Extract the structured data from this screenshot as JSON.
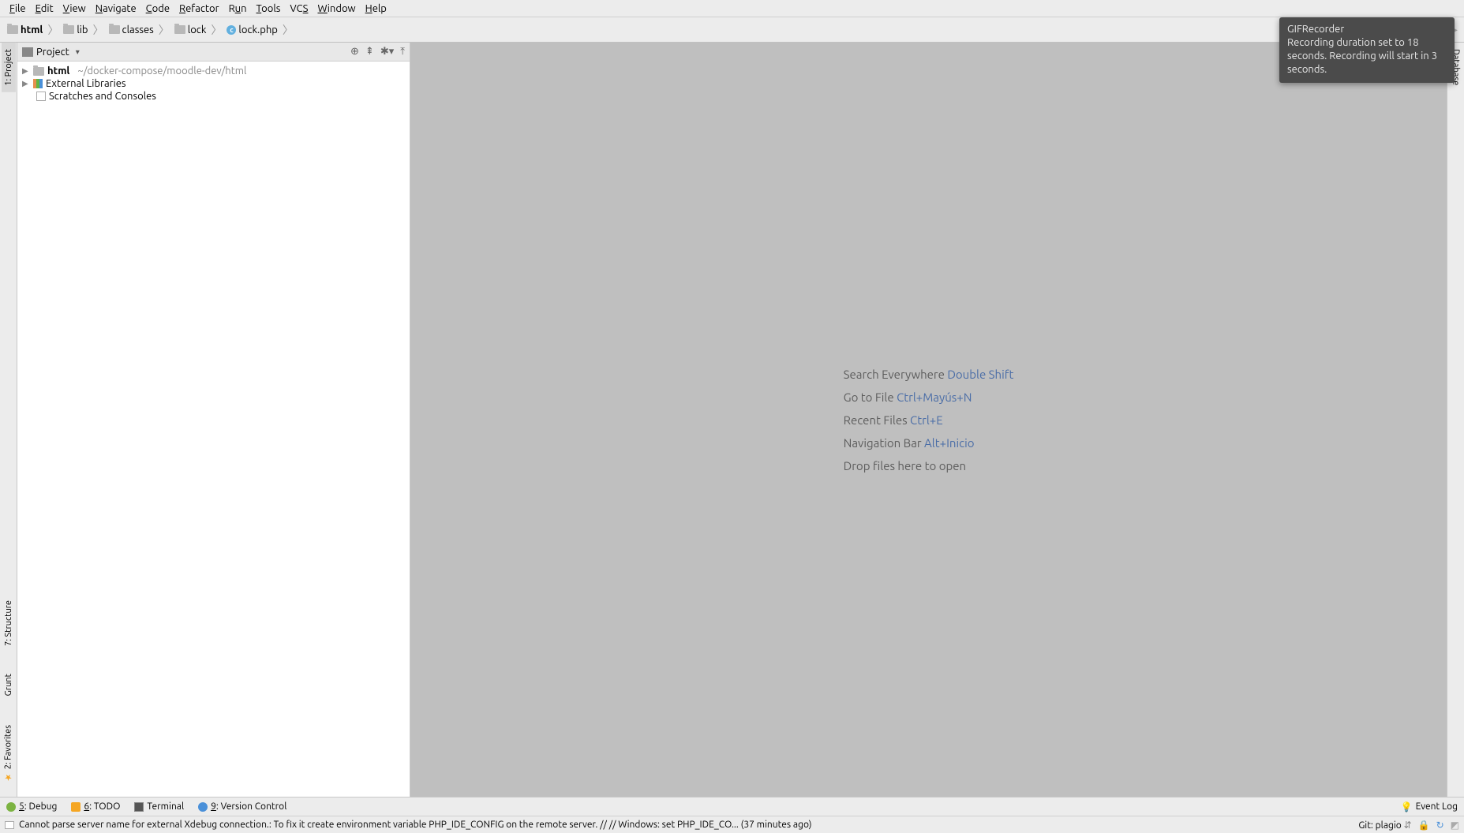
{
  "menubar": {
    "file": "File",
    "file_u": "F",
    "edit": "Edit",
    "edit_u": "E",
    "view": "View",
    "view_u": "V",
    "navigate": "Navigate",
    "navigate_u": "N",
    "code": "Code",
    "code_u": "C",
    "refactor": "Refactor",
    "refactor_u": "R",
    "run": "Run",
    "run_u": "u",
    "tools": "Tools",
    "tools_u": "T",
    "vcs": "VCS",
    "vcs_u": "S",
    "window": "Window",
    "window_u": "W",
    "help": "Help",
    "help_u": "H"
  },
  "breadcrumb": {
    "items": [
      {
        "type": "folder",
        "label": "html",
        "bold": true
      },
      {
        "type": "folder",
        "label": "lib"
      },
      {
        "type": "folder",
        "label": "classes"
      },
      {
        "type": "folder",
        "label": "lock"
      },
      {
        "type": "file",
        "label": "lock.php"
      }
    ]
  },
  "left_tabs": {
    "project": "1: Project",
    "structure": "7: Structure",
    "grunt": "Grunt",
    "favorites": "2: Favorites"
  },
  "right_tabs": {
    "database": "Database"
  },
  "project_panel": {
    "title": "Project",
    "tree": [
      {
        "label": "html",
        "path": "~/docker-compose/moodle-dev/html",
        "icon": "folder",
        "bold": true,
        "expandable": true
      },
      {
        "label": "External Libraries",
        "icon": "lib",
        "expandable": true
      },
      {
        "label": "Scratches and Consoles",
        "icon": "scratch",
        "expandable": false
      }
    ]
  },
  "editor_hints": {
    "search": {
      "label": "Search Everywhere ",
      "shortcut": "Double Shift"
    },
    "gotofile": {
      "label": "Go to File ",
      "shortcut": "Ctrl+Mayús+N"
    },
    "recent": {
      "label": "Recent Files ",
      "shortcut": "Ctrl+E"
    },
    "navbar": {
      "label": "Navigation Bar ",
      "shortcut": "Alt+Inicio"
    },
    "drop": {
      "label": "Drop files here to open"
    }
  },
  "bottom_bar": {
    "debug": "5: Debug",
    "debug_u": "5",
    "todo": "6: TODO",
    "todo_u": "6",
    "terminal": "Terminal",
    "vcs": "9: Version Control",
    "vcs_u": "9",
    "event_log": "Event Log"
  },
  "status_bar": {
    "message": "Cannot parse server name for external Xdebug connection.: To fix it create environment variable PHP_IDE_CONFIG on the remote server. // // Windows: set PHP_IDE_CO... (37 minutes ago)",
    "git": "Git: plagio"
  },
  "notification": {
    "title": "GIFRecorder",
    "body": "Recording duration set to 18 seconds. Recording will start in 3 seconds."
  }
}
